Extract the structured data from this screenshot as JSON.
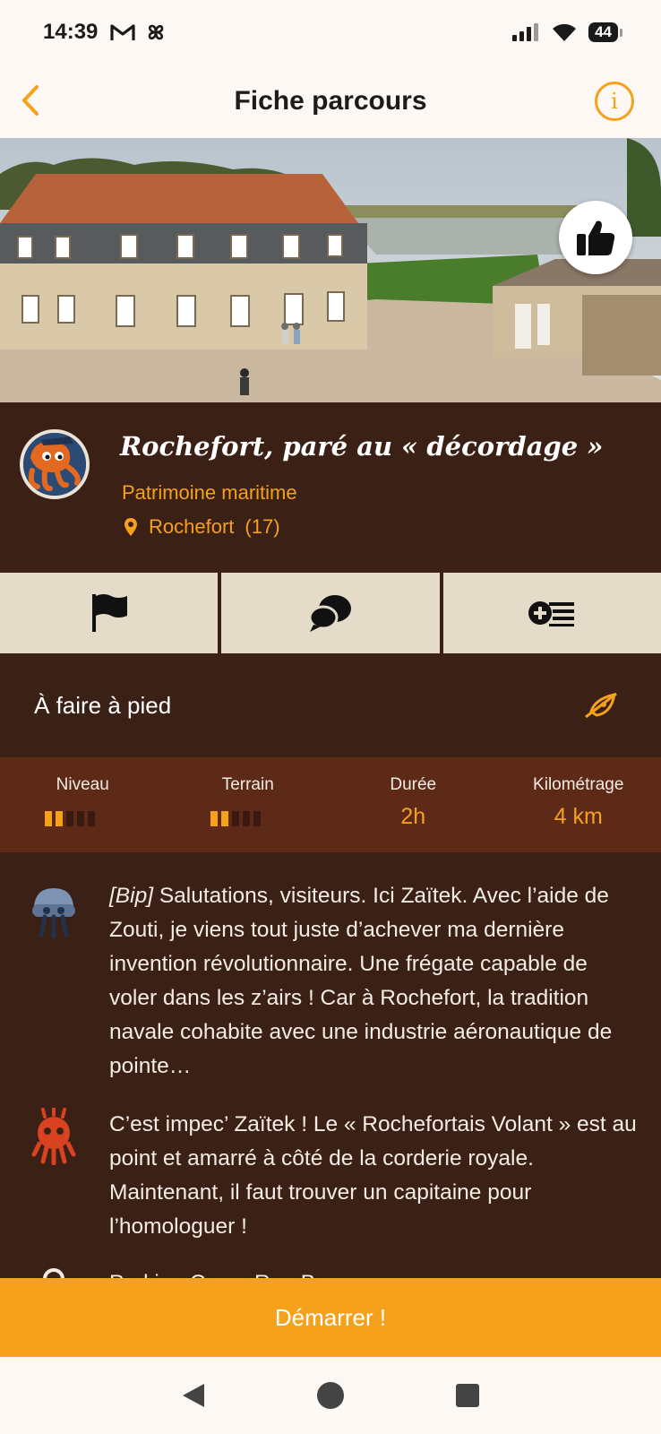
{
  "status_bar": {
    "time": "14:39",
    "battery": "44"
  },
  "header": {
    "title": "Fiche parcours"
  },
  "route": {
    "title": "Rochefort, paré au « décordage »",
    "category": "Patrimoine maritime",
    "city": "Rochefort",
    "department": "(17)"
  },
  "mode": {
    "label": "À faire à pied"
  },
  "stats": {
    "level": {
      "label": "Niveau",
      "filled": 2,
      "total": 5
    },
    "terrain": {
      "label": "Terrain",
      "filled": 2,
      "total": 5
    },
    "duration": {
      "label": "Durée",
      "value": "2h"
    },
    "distance": {
      "label": "Kilométrage",
      "value": "4 km"
    }
  },
  "story": [
    {
      "prefix": "[Bip]",
      "text": " Salutations, visiteurs. Ici Zaïtek. Avec l’aide de Zouti, je viens tout juste d’achever ma dernière invention révolutionnaire. Une frégate capable de voler dans les z’airs ! Car à Rochefort, la tradition navale cohabite avec une industrie aéronautique de pointe…"
    },
    {
      "prefix": "",
      "text": "C’est impec’ Zaïtek ! Le « Rochefortais Volant » est au point et amarré à côté de la corderie royale. Maintenant, il faut trouver un capitaine pour l’homologuer !"
    },
    {
      "prefix": "",
      "text": "Parking Cours Roy-Bry..."
    }
  ],
  "start_button": {
    "label": "Démarrer !"
  },
  "colors": {
    "accent": "#f5a11c",
    "background": "#3b2016",
    "stats_band": "#5e2a18",
    "action_tile": "#e4dcc8"
  },
  "icons": [
    "back-chevron-icon",
    "info-icon",
    "thumbs-up-icon",
    "location-pin-icon",
    "flag-icon",
    "chat-bubbles-icon",
    "add-list-icon",
    "rocket-icon",
    "robot-icon",
    "octopus-icon"
  ]
}
